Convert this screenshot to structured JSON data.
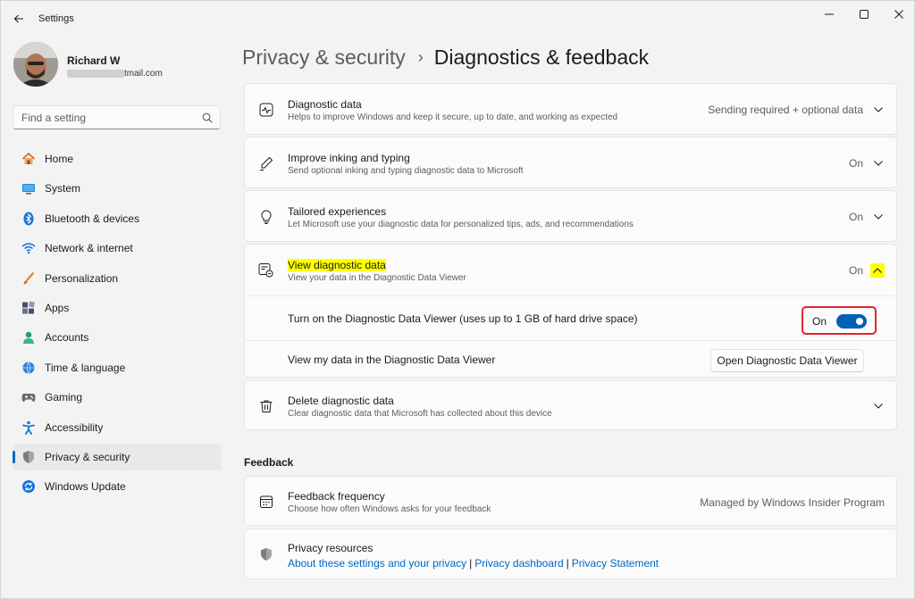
{
  "app": {
    "title": "Settings"
  },
  "profile": {
    "name": "Richard W",
    "email_suffix": "tmail.com"
  },
  "search": {
    "placeholder": "Find a setting"
  },
  "nav": {
    "items": [
      {
        "label": "Home",
        "icon": "home-icon"
      },
      {
        "label": "System",
        "icon": "system-icon"
      },
      {
        "label": "Bluetooth & devices",
        "icon": "bluetooth-icon"
      },
      {
        "label": "Network & internet",
        "icon": "wifi-icon"
      },
      {
        "label": "Personalization",
        "icon": "brush-icon"
      },
      {
        "label": "Apps",
        "icon": "apps-icon"
      },
      {
        "label": "Accounts",
        "icon": "accounts-icon"
      },
      {
        "label": "Time & language",
        "icon": "time-language-icon"
      },
      {
        "label": "Gaming",
        "icon": "gaming-icon"
      },
      {
        "label": "Accessibility",
        "icon": "accessibility-icon"
      },
      {
        "label": "Privacy & security",
        "icon": "shield-icon",
        "active": true
      },
      {
        "label": "Windows Update",
        "icon": "windows-update-icon"
      }
    ]
  },
  "breadcrumb": {
    "parent": "Privacy & security",
    "separator": "›",
    "current": "Diagnostics & feedback"
  },
  "settings": {
    "diagnostic_data": {
      "title": "Diagnostic data",
      "description": "Helps to improve Windows and keep it secure, up to date, and working as expected",
      "value": "Sending required + optional data"
    },
    "inking_typing": {
      "title": "Improve inking and typing",
      "description": "Send optional inking and typing diagnostic data to Microsoft",
      "value": "On"
    },
    "tailored": {
      "title": "Tailored experiences",
      "description": "Let Microsoft use your diagnostic data for personalized tips, ads, and recommendations",
      "value": "On"
    },
    "view_data": {
      "title": "View diagnostic data",
      "description": "View your data in the Diagnostic Data Viewer",
      "value": "On",
      "toggle_row_label": "Turn on the Diagnostic Data Viewer (uses up to 1 GB of hard drive space)",
      "toggle_state": "On",
      "viewer_row_label": "View my data in the Diagnostic Data Viewer",
      "viewer_button": "Open Diagnostic Data Viewer"
    },
    "delete_data": {
      "title": "Delete diagnostic data",
      "description": "Clear diagnostic data that Microsoft has collected about this device"
    }
  },
  "feedback": {
    "heading": "Feedback",
    "frequency": {
      "title": "Feedback frequency",
      "description": "Choose how often Windows asks for your feedback",
      "value": "Managed by Windows Insider Program"
    },
    "privacy_resources": {
      "title": "Privacy resources",
      "links": [
        "About these settings and your privacy",
        "Privacy dashboard",
        "Privacy Statement"
      ],
      "link_separator": "|"
    }
  },
  "colors": {
    "accent": "#0067c0",
    "toggle_on": "#005fb8",
    "highlight": "#ffff00",
    "annotation_border": "#e0242f"
  }
}
